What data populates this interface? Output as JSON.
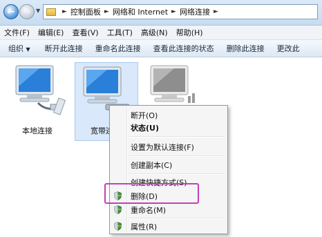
{
  "addressbar": {
    "crumbs": [
      "控制面板",
      "网络和 Internet",
      "网络连接"
    ]
  },
  "menubar": {
    "items": [
      "文件(F)",
      "编辑(E)",
      "查看(V)",
      "工具(T)",
      "高级(N)",
      "帮助(H)"
    ]
  },
  "toolbar": {
    "organize": "组织",
    "commands": [
      "断开此连接",
      "重命名此连接",
      "查看此连接的状态",
      "删除此连接",
      "更改此"
    ]
  },
  "connections": [
    {
      "name": "本地连接",
      "state": "connected"
    },
    {
      "name": "宽带连",
      "state": "selected"
    },
    {
      "name": "",
      "state": "disabled"
    }
  ],
  "context_menu": {
    "items": [
      "断开(O)",
      "状态(U)",
      "设置为默认连接(F)",
      "创建副本(C)",
      "创建快捷方式(S)",
      "删除(D)",
      "重命名(M)",
      "属性(R)"
    ],
    "bold_item": "状态(U)",
    "highlighted_item": "删除(D)"
  },
  "colors": {
    "highlight_border": "#c23fb5",
    "selection_bg": "#d9e8fb"
  }
}
